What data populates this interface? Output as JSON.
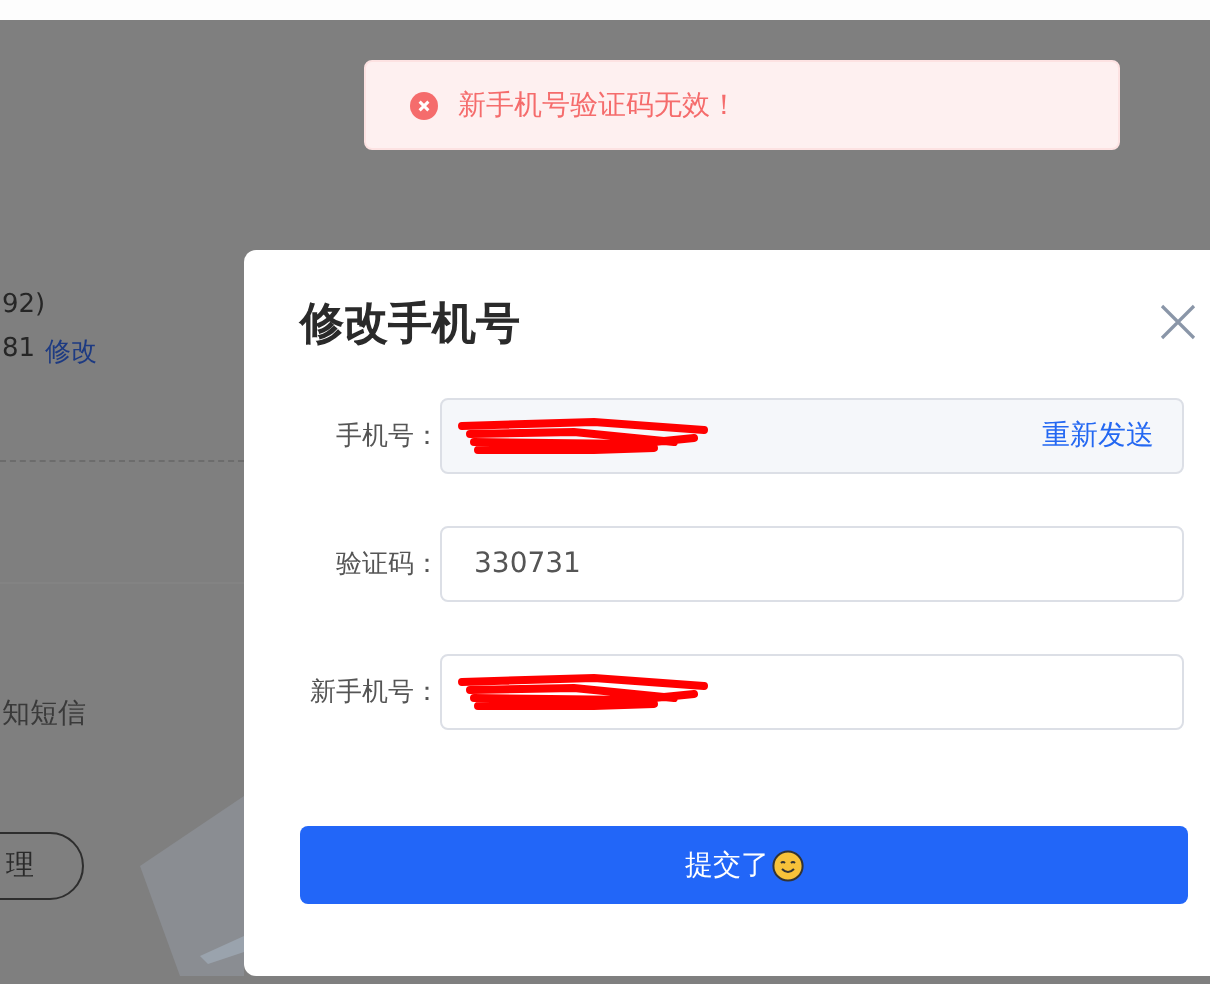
{
  "toast": {
    "kind": "error",
    "message": "新手机号验证码无效！"
  },
  "background": {
    "lines": [
      "92)",
      "81"
    ],
    "edit_link": "修改",
    "sms_text": "知短信",
    "button": "理"
  },
  "dialog": {
    "title": "修改手机号",
    "fields": [
      {
        "label": "手机号：",
        "kind": "readonly",
        "redacted": true,
        "action": "重新发送"
      },
      {
        "label": "验证码：",
        "kind": "input",
        "redacted": false,
        "value": "330731"
      },
      {
        "label": "新手机号：",
        "kind": "input",
        "redacted": true
      }
    ],
    "submit": "提交了"
  }
}
